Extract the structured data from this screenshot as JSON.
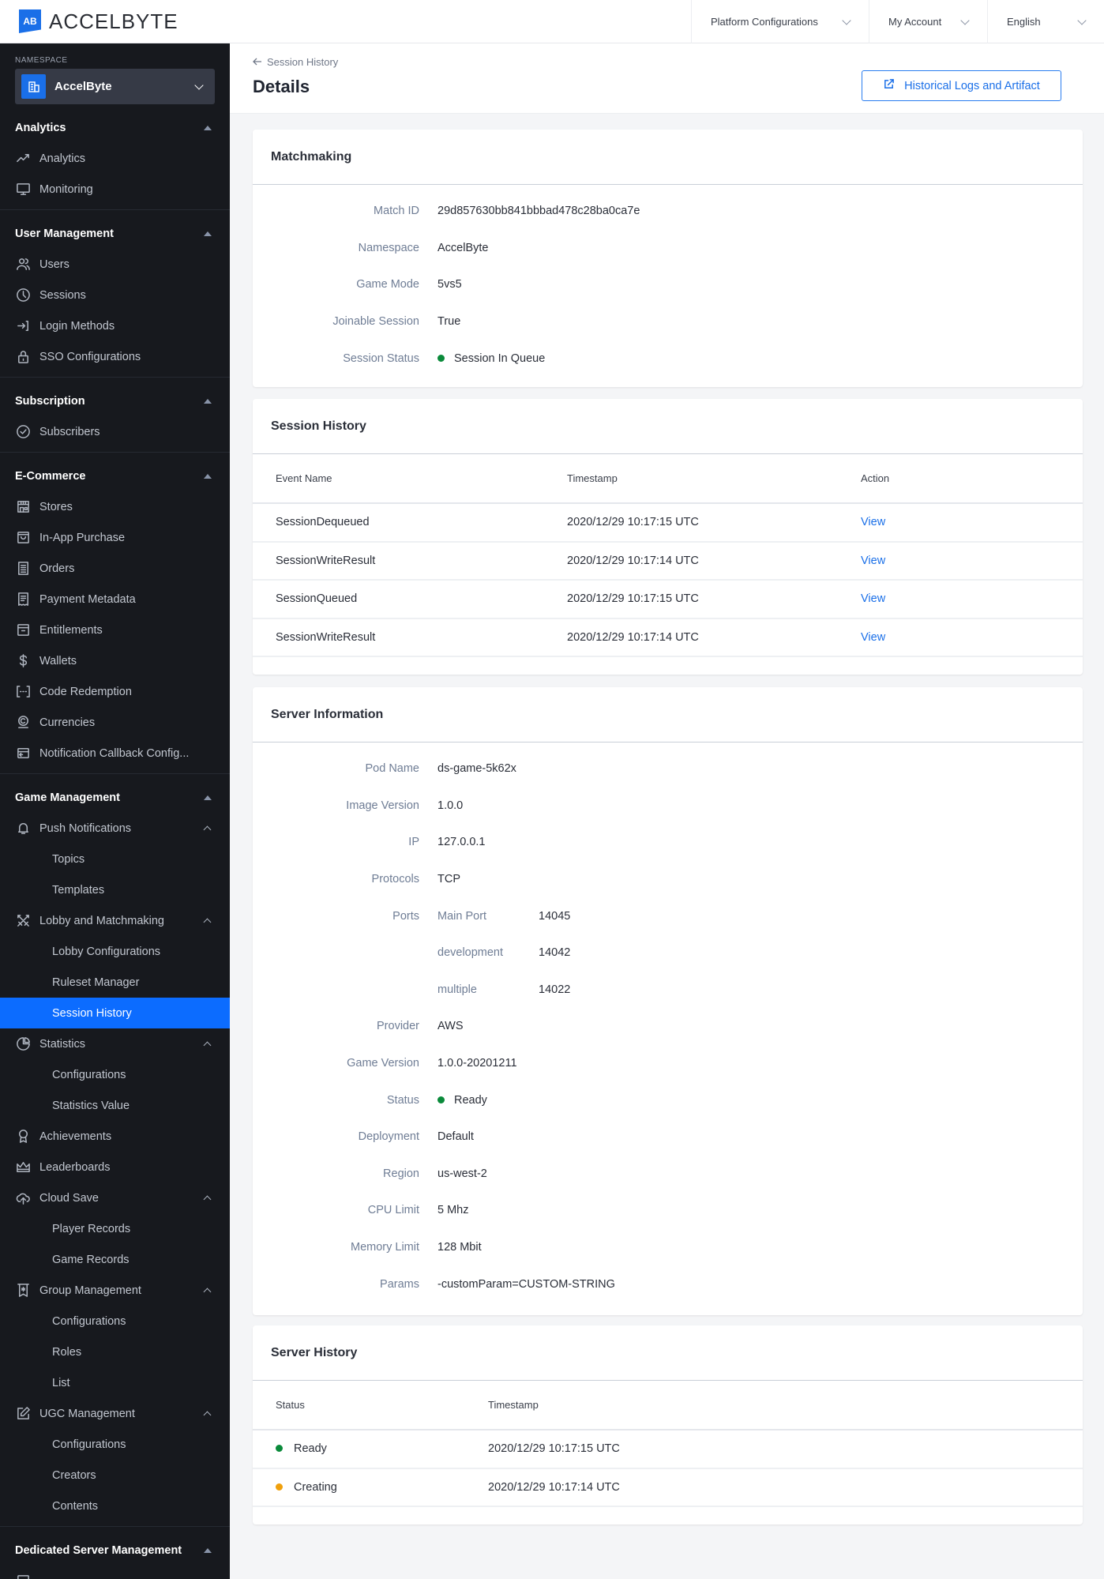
{
  "brand": {
    "logo_mark": "AB",
    "name": "ACCELBYTE"
  },
  "topbar": {
    "menus": [
      {
        "label": "Platform Configurations"
      },
      {
        "label": "My Account"
      },
      {
        "label": "English"
      }
    ]
  },
  "sidebar": {
    "namespace_label": "NAMESPACE",
    "namespace_value": "AccelByte",
    "sections": {
      "analytics": {
        "title": "Analytics",
        "items": [
          "Analytics",
          "Monitoring"
        ]
      },
      "user_management": {
        "title": "User Management",
        "items": [
          "Users",
          "Sessions",
          "Login Methods",
          "SSO Configurations"
        ]
      },
      "subscription": {
        "title": "Subscription",
        "items": [
          "Subscribers"
        ]
      },
      "ecommerce": {
        "title": "E-Commerce",
        "items": [
          "Stores",
          "In-App Purchase",
          "Orders",
          "Payment Metadata",
          "Entitlements",
          "Wallets",
          "Code Redemption",
          "Currencies",
          "Notification Callback Config..."
        ]
      },
      "game_management": {
        "title": "Game Management",
        "push_notifications": {
          "label": "Push Notifications",
          "children": [
            "Topics",
            "Templates"
          ]
        },
        "lobby": {
          "label": "Lobby and Matchmaking",
          "children": [
            "Lobby Configurations",
            "Ruleset Manager",
            "Session History"
          ]
        },
        "statistics": {
          "label": "Statistics",
          "children": [
            "Configurations",
            "Statistics Value"
          ]
        },
        "achievements": "Achievements",
        "leaderboards": "Leaderboards",
        "cloud_save": {
          "label": "Cloud Save",
          "children": [
            "Player Records",
            "Game Records"
          ]
        },
        "group_management": {
          "label": "Group Management",
          "children": [
            "Configurations",
            "Roles",
            "List"
          ]
        },
        "ugc_management": {
          "label": "UGC Management",
          "children": [
            "Configurations",
            "Creators",
            "Contents"
          ]
        }
      },
      "dedicated_server": {
        "title": "Dedicated Server Management"
      }
    },
    "active_item": "Session History"
  },
  "page": {
    "breadcrumb": "Session History",
    "title": "Details",
    "historical_button": "Historical Logs and Artifact"
  },
  "matchmaking": {
    "title": "Matchmaking",
    "fields": [
      {
        "label": "Match ID",
        "value": "29d857630bb841bbbad478c28ba0ca7e"
      },
      {
        "label": "Namespace",
        "value": "AccelByte"
      },
      {
        "label": "Game Mode",
        "value": "5vs5"
      },
      {
        "label": "Joinable Session",
        "value": "True"
      },
      {
        "label": "Session Status",
        "value": "Session In Queue",
        "status_color": "#0a8a3a"
      }
    ]
  },
  "session_history": {
    "title": "Session History",
    "columns": [
      "Event Name",
      "Timestamp",
      "Action"
    ],
    "rows": [
      {
        "event": "SessionDequeued",
        "timestamp": "2020/12/29 10:17:15 UTC",
        "action": "View"
      },
      {
        "event": "SessionWriteResult",
        "timestamp": "2020/12/29 10:17:14 UTC",
        "action": "View"
      },
      {
        "event": "SessionQueued",
        "timestamp": "2020/12/29 10:17:15 UTC",
        "action": "View"
      },
      {
        "event": "SessionWriteResult",
        "timestamp": "2020/12/29 10:17:14 UTC",
        "action": "View"
      }
    ]
  },
  "server_information": {
    "title": "Server Information",
    "pod_name": {
      "label": "Pod Name",
      "value": "ds-game-5k62x"
    },
    "image_version": {
      "label": "Image Version",
      "value": "1.0.0"
    },
    "ip": {
      "label": "IP",
      "value": "127.0.0.1"
    },
    "protocols": {
      "label": "Protocols",
      "value": "TCP"
    },
    "ports": {
      "label": "Ports",
      "entries": [
        {
          "name": "Main Port",
          "value": "14045"
        },
        {
          "name": "development",
          "value": "14042"
        },
        {
          "name": "multiple",
          "value": "14022"
        }
      ]
    },
    "provider": {
      "label": "Provider",
      "value": "AWS"
    },
    "game_version": {
      "label": "Game Version",
      "value": "1.0.0-20201211"
    },
    "status": {
      "label": "Status",
      "value": "Ready",
      "status_color": "#0a8a3a"
    },
    "deployment": {
      "label": "Deployment",
      "value": "Default"
    },
    "region": {
      "label": "Region",
      "value": "us-west-2"
    },
    "cpu_limit": {
      "label": "CPU Limit",
      "value": "5 Mhz"
    },
    "memory_limit": {
      "label": "Memory Limit",
      "value": "128 Mbit"
    },
    "params": {
      "label": "Params",
      "value": "-customParam=CUSTOM-STRING"
    }
  },
  "server_history": {
    "title": "Server History",
    "columns": [
      "Status",
      "Timestamp"
    ],
    "rows": [
      {
        "status": "Ready",
        "timestamp": "2020/12/29 10:17:15 UTC",
        "color": "#0a8a3a"
      },
      {
        "status": "Creating",
        "timestamp": "2020/12/29 10:17:14 UTC",
        "color": "#f0a00c"
      }
    ]
  },
  "colors": {
    "accent": "#0c6cff",
    "link": "#1a6fe8",
    "sidebar_bg": "#17191e",
    "success": "#0a8a3a",
    "warning": "#f0a00c"
  }
}
